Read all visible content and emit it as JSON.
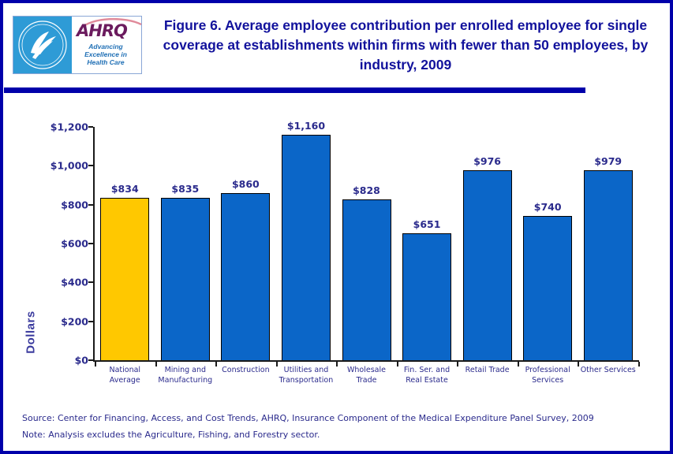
{
  "header": {
    "title": "Figure 6. Average employee contribution per enrolled employee for single coverage at establishments within firms with fewer than 50 employees, by industry, 2009",
    "logo": {
      "hhs_icon": "hhs-seal-icon",
      "ahrq_word": "AHRQ",
      "tagline_1": "Advancing",
      "tagline_2": "Excellence in",
      "tagline_3": "Health Care"
    }
  },
  "chart_data": {
    "type": "bar",
    "title": "Figure 6. Average employee contribution per enrolled employee for single coverage at establishments within firms with fewer than 50 employees, by industry, 2009",
    "xlabel": "",
    "ylabel": "Dollars",
    "ylim": [
      0,
      1200
    ],
    "ytick_values": [
      0,
      200,
      400,
      600,
      800,
      1000,
      1200
    ],
    "ytick_labels": [
      "$0",
      "$200",
      "$400",
      "$600",
      "$800",
      "$1,000",
      "$1,200"
    ],
    "grid": false,
    "legend": "none",
    "categories": [
      "National Average",
      "Mining and Manufacturing",
      "Construction",
      "Utilities and Transportation",
      "Wholesale Trade",
      "Fin. Ser. and Real Estate",
      "Retail Trade",
      "Professional Services",
      "Other Services"
    ],
    "category_lines": [
      [
        "National",
        "Average"
      ],
      [
        "Mining and",
        "Manufacturing"
      ],
      [
        "Construction",
        ""
      ],
      [
        "Utilities and",
        "Transportation"
      ],
      [
        "Wholesale",
        "Trade"
      ],
      [
        "Fin. Ser. and",
        "Real Estate"
      ],
      [
        "Retail Trade",
        ""
      ],
      [
        "Professional",
        "Services"
      ],
      [
        "Other Services",
        ""
      ]
    ],
    "values": [
      834,
      835,
      860,
      1160,
      828,
      651,
      976,
      740,
      979
    ],
    "value_labels": [
      "$834",
      "$835",
      "$860",
      "$1,160",
      "$828",
      "$651",
      "$976",
      "$740",
      "$979"
    ],
    "bar_colors": [
      "#FFC800",
      "#0B66C8",
      "#0B66C8",
      "#0B66C8",
      "#0B66C8",
      "#0B66C8",
      "#0B66C8",
      "#0B66C8",
      "#0B66C8"
    ],
    "highlight_color": "#FFC800",
    "series_color": "#0B66C8"
  },
  "footer": {
    "source": "Source: Center for Financing, Access, and Cost Trends, AHRQ, Insurance Component of the Medical Expenditure Panel Survey, 2009",
    "note": "Note: Analysis excludes the Agriculture, Fishing, and Forestry sector."
  },
  "colors": {
    "border": "#0000AA",
    "title_text": "#12129C",
    "axis_text": "#2A2A8C",
    "bar_blue": "#0B66C8",
    "bar_yellow": "#FFC800"
  }
}
